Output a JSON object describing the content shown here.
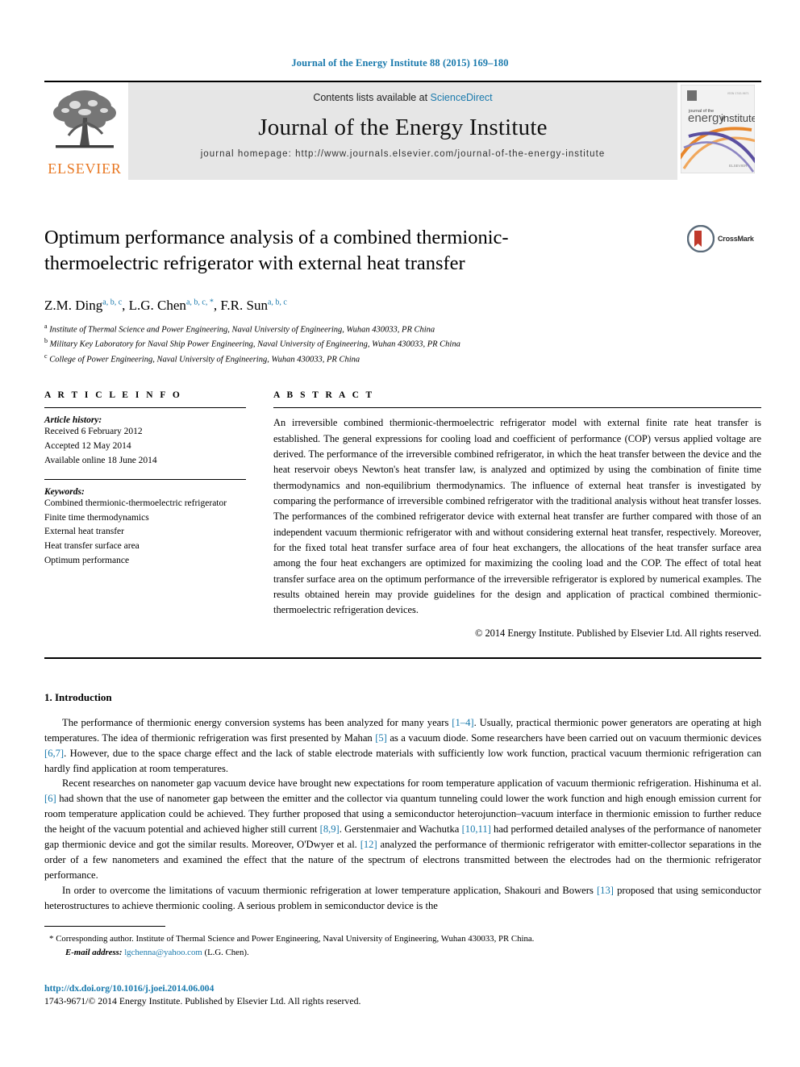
{
  "running_head": "Journal of the Energy Institute 88 (2015) 169–180",
  "masthead": {
    "publisher_name": "ELSEVIER",
    "contents_prefix": "Contents lists available at ",
    "sciencedirect": "ScienceDirect",
    "journal_title": "Journal of the Energy Institute",
    "homepage_label": "journal homepage: ",
    "homepage_url": "http://www.journals.elsevier.com/journal-of-the-energy-institute",
    "cover_text_top": "journal of the",
    "cover_text_main_a": "energy",
    "cover_text_main_b": "institute"
  },
  "article": {
    "title": "Optimum performance analysis of a combined thermionic-thermoelectric refrigerator with external heat transfer",
    "crossmark_label": "CrossMark",
    "authors": [
      {
        "name": "Z.M. Ding",
        "marks": "a, b, c",
        "sep": ", "
      },
      {
        "name": "L.G. Chen",
        "marks": "a, b, c, *",
        "sep": ", "
      },
      {
        "name": "F.R. Sun",
        "marks": "a, b, c",
        "sep": ""
      }
    ],
    "affiliations": [
      {
        "mark": "a",
        "text": "Institute of Thermal Science and Power Engineering, Naval University of Engineering, Wuhan 430033, PR China"
      },
      {
        "mark": "b",
        "text": "Military Key Laboratory for Naval Ship Power Engineering, Naval University of Engineering, Wuhan 430033, PR China"
      },
      {
        "mark": "c",
        "text": "College of Power Engineering, Naval University of Engineering, Wuhan 430033, PR China"
      }
    ]
  },
  "article_info": {
    "heading": "A R T I C L E   I N F O",
    "history_label": "Article history:",
    "history": [
      "Received 6 February 2012",
      "Accepted 12 May 2014",
      "Available online 18 June 2014"
    ],
    "keywords_label": "Keywords:",
    "keywords": [
      "Combined thermionic-thermoelectric refrigerator",
      "Finite time thermodynamics",
      "External heat transfer",
      "Heat transfer surface area",
      "Optimum performance"
    ]
  },
  "abstract": {
    "heading": "A B S T R A C T",
    "text": "An irreversible combined thermionic-thermoelectric refrigerator model with external finite rate heat transfer is established. The general expressions for cooling load and coefficient of performance (COP) versus applied voltage are derived. The performance of the irreversible combined refrigerator, in which the heat transfer between the device and the heat reservoir obeys Newton's heat transfer law, is analyzed and optimized by using the combination of finite time thermodynamics and non-equilibrium thermodynamics. The influence of external heat transfer is investigated by comparing the performance of irreversible combined refrigerator with the traditional analysis without heat transfer losses. The performances of the combined refrigerator device with external heat transfer are further compared with those of an independent vacuum thermionic refrigerator with and without considering external heat transfer, respectively. Moreover, for the fixed total heat transfer surface area of four heat exchangers, the allocations of the heat transfer surface area among the four heat exchangers are optimized for maximizing the cooling load and the COP. The effect of total heat transfer surface area on the optimum performance of the irreversible refrigerator is explored by numerical examples. The results obtained herein may provide guidelines for the design and application of practical combined thermionic-thermoelectric refrigeration devices.",
    "copyright": "© 2014 Energy Institute. Published by Elsevier Ltd. All rights reserved."
  },
  "introduction": {
    "heading": "1.  Introduction",
    "paragraphs": [
      "The performance of thermionic energy conversion systems has been analyzed for many years [1–4]. Usually, practical thermionic power generators are operating at high temperatures. The idea of thermionic refrigeration was first presented by Mahan [5] as a vacuum diode. Some researchers have been carried out on vacuum thermionic devices [6,7]. However, due to the space charge effect and the lack of stable electrode materials with sufficiently low work function, practical vacuum thermionic refrigeration can hardly find application at room temperatures.",
      "Recent researches on nanometer gap vacuum device have brought new expectations for room temperature application of vacuum thermionic refrigeration. Hishinuma et al. [6] had shown that the use of nanometer gap between the emitter and the collector via quantum tunneling could lower the work function and high enough emission current for room temperature application could be achieved. They further proposed that using a semiconductor heterojunction–vacuum interface in thermionic emission to further reduce the height of the vacuum potential and achieved higher still current [8,9]. Gerstenmaier and Wachutka [10,11] had performed detailed analyses of the performance of nanometer gap thermionic device and got the similar results. Moreover, O'Dwyer et al. [12] analyzed the performance of thermionic refrigerator with emitter-collector separations in the order of a few nanometers and examined the effect that the nature of the spectrum of electrons transmitted between the electrodes had on the thermionic refrigerator performance.",
      "In order to overcome the limitations of vacuum thermionic refrigeration at lower temperature application, Shakouri and Bowers [13] proposed that using semiconductor heterostructures to achieve thermionic cooling. A serious problem in semiconductor device is the"
    ]
  },
  "footnote": {
    "star": "*",
    "corresponding": "Corresponding author. Institute of Thermal Science and Power Engineering, Naval University of Engineering, Wuhan 430033, PR China.",
    "email_label": "E-mail address:",
    "email": "lgchenna@yahoo.com",
    "email_suffix": "(L.G. Chen)."
  },
  "publication_footer": {
    "doi": "http://dx.doi.org/10.1016/j.joei.2014.06.004",
    "issn_line": "1743-9671/© 2014 Energy Institute. Published by Elsevier Ltd. All rights reserved."
  },
  "colors": {
    "link_blue": "#1a7aad",
    "elsevier_orange": "#e87722",
    "masthead_grey": "#e6e6e6",
    "crossmark_red": "#c0392b"
  }
}
